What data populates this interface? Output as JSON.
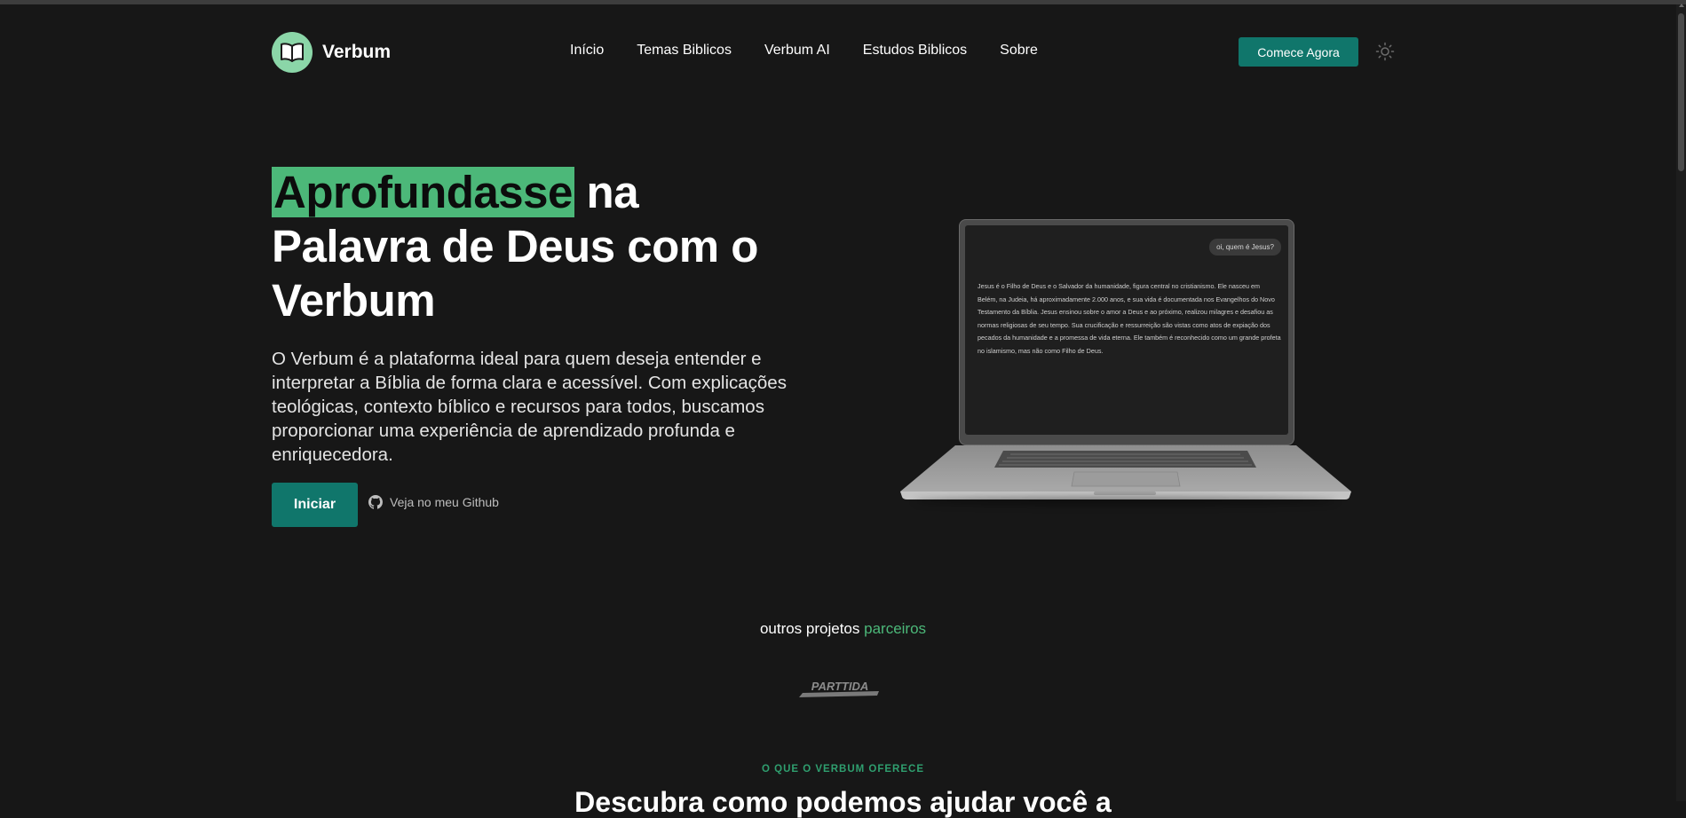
{
  "header": {
    "brand": "Verbum",
    "nav": [
      "Início",
      "Temas Biblicos",
      "Verbum AI",
      "Estudos Biblicos",
      "Sobre"
    ],
    "cta_label": "Comece Agora",
    "theme_icon": "sun-icon"
  },
  "hero": {
    "title_highlight": "Aprofundasse",
    "title_rest": " na Palavra de Deus com o Verbum",
    "description": "O Verbum é a plataforma ideal para quem deseja entender e interpretar a Bíblia de forma clara e acessível. Com explicações teológicas, contexto bíblico e recursos para todos, buscamos proporcionar uma experiência de aprendizado profunda e enriquecedora.",
    "start_label": "Iniciar",
    "github_label": "Veja no meu Github"
  },
  "demo": {
    "question": "oi, quem é Jesus?",
    "answer": "Jesus é o Filho de Deus e o Salvador da humanidade, figura central no cristianismo. Ele nasceu em Belém, na Judeia, há aproximadamente 2.000 anos, e sua vida é documentada nos Evangelhos do Novo Testamento da Bíblia. Jesus ensinou sobre o amor a Deus e ao próximo, realizou milagres e desafiou as normas religiosas de seu tempo. Sua crucificação e ressurreição são vistas como atos de expiação dos pecados da humanidade e a promessa de vida eterna. Ele também é reconhecido como um grande profeta no islamismo, mas não como Filho de Deus."
  },
  "partners": {
    "label": "outros projetos",
    "label_highlight": "parceiros",
    "logo_text": "PARTTIDA"
  },
  "offer": {
    "kicker": "O QUE O VERBUM OFERECE",
    "title": "Descubra como podemos ajudar você a"
  },
  "colors": {
    "background": "#171717",
    "accent": "#10766b",
    "highlight": "#4cb879",
    "logo_bg": "#8bd6a8"
  }
}
